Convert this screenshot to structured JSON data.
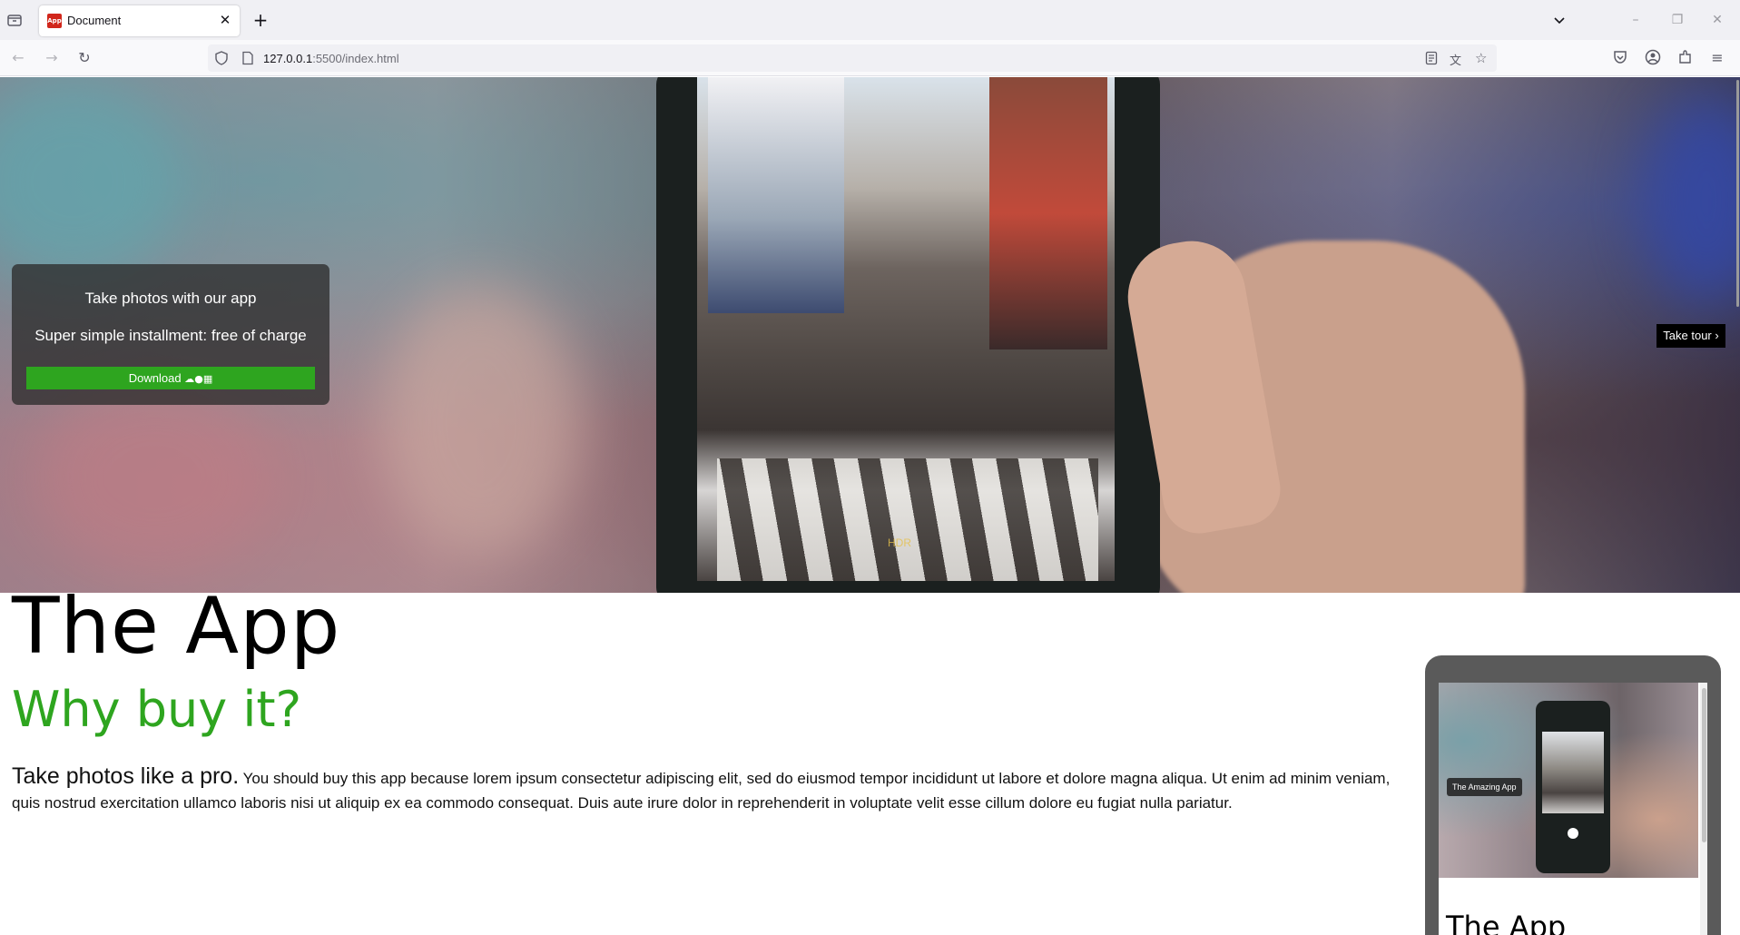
{
  "browser": {
    "tab_title": "Document",
    "tab_favicon_text": "App",
    "url_host": "127.0.0.1",
    "url_path": ":5500/index.html",
    "icons": [
      "tab-list-icon",
      "close-icon",
      "plus-icon",
      "chevron-down-icon",
      "minimize-icon",
      "restore-icon",
      "window-close-icon",
      "back-arrow-icon",
      "forward-arrow-icon",
      "reload-icon",
      "shield-icon",
      "page-icon",
      "reader-view-icon",
      "translate-icon",
      "bookmark-star-icon",
      "pocket-icon",
      "account-icon",
      "extensions-icon",
      "menu-icon"
    ]
  },
  "hero": {
    "promo_line1": "Take photos with our app",
    "promo_line2": "Super simple installment: free of charge",
    "download_label": "Download",
    "platform_icons": [
      "android-icon",
      "apple-icon",
      "windows-icon"
    ],
    "hdr_text": "HDR",
    "take_tour_label": "Take tour ›"
  },
  "content": {
    "title": "The App",
    "subtitle": "Why buy it?",
    "lead": "Take photos like a pro.",
    "body": " You should buy this app because lorem ipsum consectetur adipiscing elit, sed do eiusmod tempor incididunt ut labore et dolore magna aliqua. Ut enim ad minim veniam, quis nostrud exercitation ullamco laboris nisi ut aliquip ex ea commodo consequat. Duis aute irure dolor in reprehenderit in voluptate velit esse cillum dolore eu fugiat nulla pariatur."
  },
  "preview": {
    "badge": "The Amazing App",
    "title": "The App"
  },
  "colors": {
    "accent_green": "#2ea51f",
    "promo_bg": "#2d2d2d",
    "tour_bg": "#000000"
  }
}
